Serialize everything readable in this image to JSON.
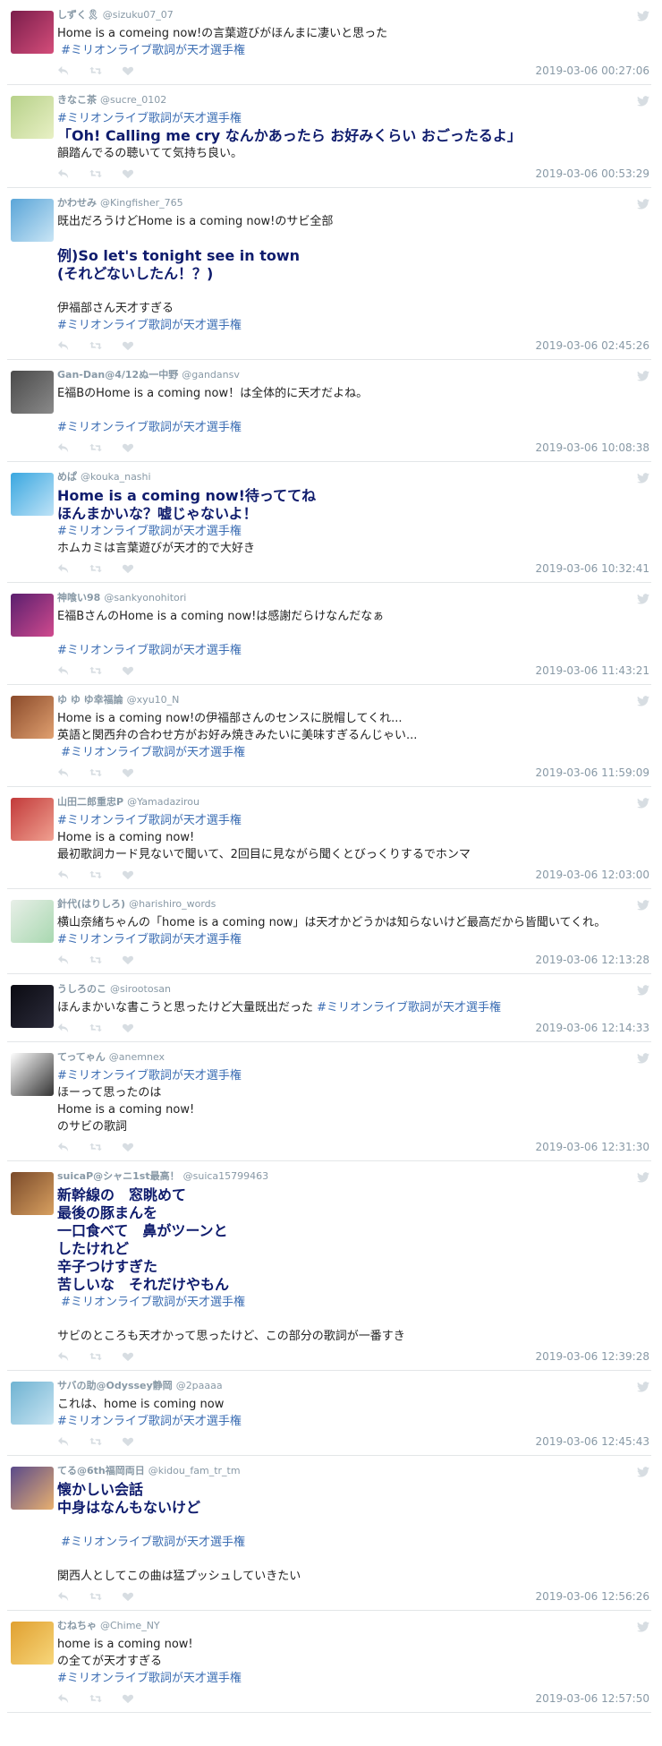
{
  "colors": {
    "hashtag": "#3b6db3",
    "big_text": "#0f1c6d",
    "meta": "#8899a6"
  },
  "tweets": [
    {
      "name": "しずく🎗",
      "handle": "@sizuku07_07",
      "time": "2019-03-06 00:27:06",
      "avatar_colors": [
        "#7a1d4b",
        "#d44d7a"
      ],
      "lines": [
        {
          "t": "Home is a comeing now!の言葉遊びがほんまに凄いと思った",
          "s": "text"
        },
        {
          "t": " #ミリオンライブ歌詞が天才選手権",
          "s": "tag"
        }
      ]
    },
    {
      "name": "きなこ茶",
      "handle": "@sucre_0102",
      "time": "2019-03-06 00:53:29",
      "avatar_colors": [
        "#b7d18a",
        "#e8f0c4"
      ],
      "lines": [
        {
          "t": "#ミリオンライブ歌詞が天才選手権",
          "s": "tag"
        },
        {
          "t": "「Oh! Calling me cry なんかあったら お好みくらい おごったるよ」",
          "s": "big"
        },
        {
          "t": "韻踏んでるの聴いてて気持ち良い。",
          "s": "text"
        }
      ]
    },
    {
      "name": "かわせみ",
      "handle": "@Kingfisher_765",
      "time": "2019-03-06 02:45:26",
      "avatar_colors": [
        "#5aa5d8",
        "#c9e5f5"
      ],
      "lines": [
        {
          "t": "既出だろうけどHome is a coming now!のサビ全部",
          "s": "text"
        },
        {
          "t": "",
          "s": "text"
        },
        {
          "t": "例)So let's tonight see in town",
          "s": "big"
        },
        {
          "t": "(それどないしたん！？)",
          "s": "big"
        },
        {
          "t": "",
          "s": "text"
        },
        {
          "t": "伊福部さん天才すぎる",
          "s": "text"
        },
        {
          "t": "#ミリオンライブ歌詞が天才選手権",
          "s": "tag"
        }
      ]
    },
    {
      "name": "Gan-Dan@4/12ぬ一中野",
      "handle": "@gandansv",
      "time": "2019-03-06 10:08:38",
      "avatar_colors": [
        "#4a4a4a",
        "#8a8a8a"
      ],
      "lines": [
        {
          "t": "E福BのHome is a coming now！は全体的に天才だよね。",
          "s": "text"
        },
        {
          "t": "",
          "s": "text"
        },
        {
          "t": "#ミリオンライブ歌詞が天才選手権",
          "s": "tag"
        }
      ]
    },
    {
      "name": "めぱ",
      "handle": "@kouka_nashi",
      "time": "2019-03-06 10:32:41",
      "avatar_colors": [
        "#3aa7e0",
        "#bfe3f7"
      ],
      "lines": [
        {
          "t": "Home is a coming now!待っててね",
          "s": "big"
        },
        {
          "t": "ほんまかいな？嘘じゃないよ！",
          "s": "big"
        },
        {
          "t": "#ミリオンライブ歌詞が天才選手権",
          "s": "tag"
        },
        {
          "t": "ホムカミは言葉遊びが天才的で大好き",
          "s": "text"
        }
      ]
    },
    {
      "name": "神喰い98",
      "handle": "@sankyonohitori",
      "time": "2019-03-06 11:43:21",
      "avatar_colors": [
        "#5a1f6e",
        "#d04a8e"
      ],
      "lines": [
        {
          "t": "E福BさんのHome is a coming now!は感謝だらけなんだなぁ",
          "s": "text"
        },
        {
          "t": "",
          "s": "text"
        },
        {
          "t": "#ミリオンライブ歌詞が天才選手権",
          "s": "tag"
        }
      ]
    },
    {
      "name": "ゆ ゆ ゆ幸福論",
      "handle": "@xyu10_N",
      "time": "2019-03-06 11:59:09",
      "avatar_colors": [
        "#8a4a2a",
        "#e0a070"
      ],
      "lines": [
        {
          "t": "Home is a coming now!の伊福部さんのセンスに脱帽してくれ...",
          "s": "text"
        },
        {
          "t": "英語と関西弁の合わせ方がお好み焼きみたいに美味すぎるんじゃい...",
          "s": "text"
        },
        {
          "t": " #ミリオンライブ歌詞が天才選手権",
          "s": "tag"
        }
      ]
    },
    {
      "name": "山田二郎重忠P",
      "handle": "@Yamadazirou",
      "time": "2019-03-06 12:03:00",
      "avatar_colors": [
        "#c23a3a",
        "#f0a090"
      ],
      "lines": [
        {
          "t": "#ミリオンライブ歌詞が天才選手権",
          "s": "tag"
        },
        {
          "t": "Home is a coming now!",
          "s": "text"
        },
        {
          "t": "最初歌詞カード見ないで聞いて、2回目に見ながら聞くとびっくりするでホンマ",
          "s": "text"
        }
      ]
    },
    {
      "name": "針代(はりしろ)",
      "handle": "@harishiro_words",
      "time": "2019-03-06 12:13:28",
      "avatar_colors": [
        "#e8efe8",
        "#a8d8b0"
      ],
      "lines": [
        {
          "t": "横山奈緒ちゃんの「home is a coming now」は天才かどうかは知らないけど最高だから皆聞いてくれ。",
          "s": "text"
        },
        {
          "t": "#ミリオンライブ歌詞が天才選手権",
          "s": "tag"
        }
      ]
    },
    {
      "name": "うしろのこ",
      "handle": "@sirootosan",
      "time": "2019-03-06 12:14:33",
      "avatar_colors": [
        "#0b0b12",
        "#2b2b3a"
      ],
      "lines": [
        {
          "t": "ほんまかいな書こうと思ったけど大量既出だった ",
          "s": "text",
          "tag_inline": "#ミリオンライブ歌詞が天才選手権"
        }
      ]
    },
    {
      "name": "てってゃん",
      "handle": "@anemnex",
      "time": "2019-03-06 12:31:30",
      "avatar_colors": [
        "#ffffff",
        "#333333"
      ],
      "lines": [
        {
          "t": "#ミリオンライブ歌詞が天才選手権",
          "s": "tag"
        },
        {
          "t": "ほーって思ったのは",
          "s": "text"
        },
        {
          "t": "Home is a coming now!",
          "s": "text"
        },
        {
          "t": "のサビの歌詞",
          "s": "text"
        }
      ]
    },
    {
      "name": "suicaP@シャニ1st最高！",
      "handle": "@suica15799463",
      "time": "2019-03-06 12:39:28",
      "avatar_colors": [
        "#7a4a2a",
        "#d8a060"
      ],
      "lines": [
        {
          "t": "新幹線の　窓眺めて",
          "s": "big"
        },
        {
          "t": "最後の豚まんを",
          "s": "big"
        },
        {
          "t": "一口食べて　鼻がツーンと",
          "s": "big"
        },
        {
          "t": "したけれど",
          "s": "big"
        },
        {
          "t": "辛子つけすぎた",
          "s": "big"
        },
        {
          "t": "苦しいな　それだけやもん",
          "s": "big"
        },
        {
          "t": " #ミリオンライブ歌詞が天才選手権",
          "s": "tag"
        },
        {
          "t": "",
          "s": "text"
        },
        {
          "t": "サビのところも天才かって思ったけど、この部分の歌詞が一番すき",
          "s": "text"
        }
      ]
    },
    {
      "name": "サバの助@Odyssey静岡",
      "handle": "@2paaaa",
      "time": "2019-03-06 12:45:43",
      "avatar_colors": [
        "#6fb3d2",
        "#c8e4f2"
      ],
      "lines": [
        {
          "t": "これは、home is coming now",
          "s": "text"
        },
        {
          "t": "#ミリオンライブ歌詞が天才選手権",
          "s": "tag"
        }
      ]
    },
    {
      "name": "てる@6th福岡両日",
      "handle": "@kidou_fam_tr_tm",
      "time": "2019-03-06 12:56:26",
      "avatar_colors": [
        "#5a4a8a",
        "#e8b070"
      ],
      "lines": [
        {
          "t": "懐かしい会話",
          "s": "big"
        },
        {
          "t": "中身はなんもないけど",
          "s": "big"
        },
        {
          "t": "",
          "s": "text"
        },
        {
          "t": " #ミリオンライブ歌詞が天才選手権",
          "s": "tag"
        },
        {
          "t": "",
          "s": "text"
        },
        {
          "t": "関西人としてこの曲は猛プッシュしていきたい",
          "s": "text"
        }
      ]
    },
    {
      "name": "むねちゃ",
      "handle": "@Chime_NY",
      "time": "2019-03-06 12:57:50",
      "avatar_colors": [
        "#e0a030",
        "#f7d67a"
      ],
      "lines": [
        {
          "t": "home is a coming now!",
          "s": "text"
        },
        {
          "t": "の全てが天才すぎる",
          "s": "text"
        },
        {
          "t": "#ミリオンライブ歌詞が天才選手権",
          "s": "tag"
        }
      ]
    }
  ]
}
